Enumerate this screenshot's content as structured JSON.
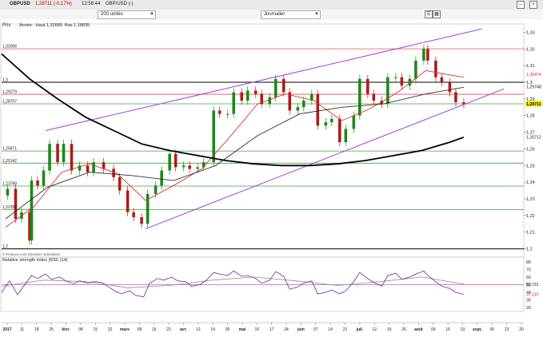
{
  "window": {
    "symbol": "GBPUSD",
    "price": "1,28711 (-0,17%)",
    "time": "12:58:44",
    "instrument": "GBP/USD (-)"
  },
  "toolbar": {
    "units_value": "200 unités",
    "period_value": "Journalier"
  },
  "main_chart": {
    "label": "Prix",
    "legend": "Année: ·Haut 1,32689 ·Bas 1,18835",
    "source": "© Finance.com Données indicatives",
    "y_ticks": [
      "1,33",
      "1,32",
      "1,31",
      "1,3",
      "1,29",
      "1,28",
      "1,27",
      "1,26",
      "1,25",
      "1,24",
      "1,23",
      "1,22",
      "1,21",
      "1,2"
    ],
    "level_labels": [
      "1,32006",
      "1,3",
      "1,29279",
      "1,28707",
      "1,25871",
      "1,25142",
      "1,23768",
      "1,22358",
      "1,2"
    ],
    "right_tags": [
      "1,30474",
      "1,29748",
      "1,28711",
      "1,26712"
    ]
  },
  "rsi": {
    "label": "Relative strength index (RSI) (14)",
    "y_ticks": [
      "80",
      "70",
      "60",
      "50",
      "40",
      "30",
      "20"
    ],
    "right_tags": [
      "50,722",
      "37,310"
    ]
  },
  "x_axis": {
    "labels": [
      "2017",
      "11",
      "18",
      "25",
      "févr.",
      "08",
      "15",
      "22",
      "mars",
      "08",
      "15",
      "22",
      "avr.",
      "12",
      "19",
      "26",
      "mai",
      "10",
      "17",
      "24",
      "juin",
      "07",
      "14",
      "21",
      "juil.",
      "12",
      "19",
      "26",
      "août",
      "09",
      "16",
      "23",
      "sept.",
      "06",
      "13",
      "20"
    ]
  },
  "colors": {
    "channel": "#a040e0",
    "level_red": "#e05050",
    "level_green": "#40a040",
    "level_black": "#000000",
    "ma_red": "#e03030",
    "ma_dark": "#303030",
    "ma_long": "#000000",
    "candle_up": "#1a8a1a",
    "candle_down": "#b01a1a",
    "rsi_line": "#7020a0",
    "rsi_signal": "#909090",
    "tag_blue": "#2040c0",
    "tag_red": "#e02020",
    "tag_current": "#f2e600"
  },
  "chart_data": {
    "type": "candlestick",
    "instrument": "GBP/USD",
    "period": "Journalier",
    "x_start": "2017-01-02",
    "x_end": "2017-09-20",
    "ylim": [
      1.195,
      1.335
    ],
    "year_high": 1.32689,
    "year_low": 1.18835,
    "horizontal_levels": [
      1.32006,
      1.3,
      1.29279,
      1.28707,
      1.25871,
      1.25142,
      1.23768,
      1.22358,
      1.2
    ],
    "channel": {
      "upper": [
        [
          "2017-01-24",
          1.271
        ],
        [
          "2017-08-30",
          1.332
        ]
      ],
      "lower": [
        [
          "2017-03-15",
          1.212
        ],
        [
          "2017-09-10",
          1.296
        ]
      ]
    },
    "close_series": [
      [
        "2017-01-02",
        1.232
      ],
      [
        "2017-01-05",
        1.236
      ],
      [
        "2017-01-09",
        1.218
      ],
      [
        "2017-01-12",
        1.222
      ],
      [
        "2017-01-16",
        1.205
      ],
      [
        "2017-01-17",
        1.241
      ],
      [
        "2017-01-20",
        1.238
      ],
      [
        "2017-01-23",
        1.247
      ],
      [
        "2017-01-26",
        1.263
      ],
      [
        "2017-01-30",
        1.252
      ],
      [
        "2017-02-02",
        1.263
      ],
      [
        "2017-02-06",
        1.247
      ],
      [
        "2017-02-10",
        1.25
      ],
      [
        "2017-02-14",
        1.246
      ],
      [
        "2017-02-17",
        1.252
      ],
      [
        "2017-02-22",
        1.248
      ],
      [
        "2017-02-27",
        1.243
      ],
      [
        "2017-03-02",
        1.235
      ],
      [
        "2017-03-06",
        1.222
      ],
      [
        "2017-03-09",
        1.219
      ],
      [
        "2017-03-13",
        1.215
      ],
      [
        "2017-03-16",
        1.233
      ],
      [
        "2017-03-20",
        1.238
      ],
      [
        "2017-03-23",
        1.247
      ],
      [
        "2017-03-27",
        1.257
      ],
      [
        "2017-03-30",
        1.249
      ],
      [
        "2017-04-03",
        1.25
      ],
      [
        "2017-04-06",
        1.248
      ],
      [
        "2017-04-10",
        1.249
      ],
      [
        "2017-04-13",
        1.252
      ],
      [
        "2017-04-18",
        1.283
      ],
      [
        "2017-04-21",
        1.281
      ],
      [
        "2017-04-25",
        1.281
      ],
      [
        "2017-04-28",
        1.294
      ],
      [
        "2017-05-02",
        1.289
      ],
      [
        "2017-05-05",
        1.295
      ],
      [
        "2017-05-09",
        1.293
      ],
      [
        "2017-05-12",
        1.287
      ],
      [
        "2017-05-16",
        1.291
      ],
      [
        "2017-05-19",
        1.302
      ],
      [
        "2017-05-23",
        1.294
      ],
      [
        "2017-05-26",
        1.283
      ],
      [
        "2017-05-30",
        1.285
      ],
      [
        "2017-06-02",
        1.289
      ],
      [
        "2017-06-06",
        1.293
      ],
      [
        "2017-06-09",
        1.274
      ],
      [
        "2017-06-13",
        1.276
      ],
      [
        "2017-06-16",
        1.278
      ],
      [
        "2017-06-20",
        1.264
      ],
      [
        "2017-06-23",
        1.272
      ],
      [
        "2017-06-27",
        1.28
      ],
      [
        "2017-06-30",
        1.302
      ],
      [
        "2017-07-04",
        1.293
      ],
      [
        "2017-07-07",
        1.289
      ],
      [
        "2017-07-11",
        1.287
      ],
      [
        "2017-07-14",
        1.303
      ],
      [
        "2017-07-18",
        1.303
      ],
      [
        "2017-07-21",
        1.298
      ],
      [
        "2017-07-25",
        1.302
      ],
      [
        "2017-07-28",
        1.313
      ],
      [
        "2017-08-01",
        1.32
      ],
      [
        "2017-08-03",
        1.313
      ],
      [
        "2017-08-07",
        1.303
      ],
      [
        "2017-08-10",
        1.3
      ],
      [
        "2017-08-14",
        1.294
      ],
      [
        "2017-08-17",
        1.288
      ],
      [
        "2017-08-21",
        1.287
      ]
    ],
    "moving_averages": [
      {
        "color": "#e03030",
        "points": [
          [
            "2017-01-04",
            1.213
          ],
          [
            "2017-01-18",
            1.225
          ],
          [
            "2017-02-01",
            1.246
          ],
          [
            "2017-02-15",
            1.251
          ],
          [
            "2017-03-01",
            1.245
          ],
          [
            "2017-03-15",
            1.229
          ],
          [
            "2017-03-29",
            1.238
          ],
          [
            "2017-04-12",
            1.248
          ],
          [
            "2017-04-26",
            1.267
          ],
          [
            "2017-05-10",
            1.287
          ],
          [
            "2017-05-24",
            1.293
          ],
          [
            "2017-06-07",
            1.289
          ],
          [
            "2017-06-21",
            1.277
          ],
          [
            "2017-07-05",
            1.284
          ],
          [
            "2017-07-19",
            1.294
          ],
          [
            "2017-08-02",
            1.307
          ],
          [
            "2017-08-16",
            1.304
          ],
          [
            "2017-08-21",
            1.303
          ]
        ]
      },
      {
        "color": "#303030",
        "points": [
          [
            "2017-01-04",
            1.218
          ],
          [
            "2017-01-25",
            1.237
          ],
          [
            "2017-02-15",
            1.246
          ],
          [
            "2017-03-08",
            1.244
          ],
          [
            "2017-03-29",
            1.241
          ],
          [
            "2017-04-19",
            1.25
          ],
          [
            "2017-05-10",
            1.268
          ],
          [
            "2017-05-31",
            1.281
          ],
          [
            "2017-06-21",
            1.285
          ],
          [
            "2017-07-12",
            1.287
          ],
          [
            "2017-08-02",
            1.293
          ],
          [
            "2017-08-21",
            1.297
          ]
        ]
      },
      {
        "color": "#000000",
        "points": [
          [
            "2017-01-02",
            1.317
          ],
          [
            "2017-01-16",
            1.302
          ],
          [
            "2017-01-30",
            1.29
          ],
          [
            "2017-02-13",
            1.279
          ],
          [
            "2017-02-27",
            1.271
          ],
          [
            "2017-03-13",
            1.263
          ],
          [
            "2017-03-27",
            1.259
          ],
          [
            "2017-04-10",
            1.256
          ],
          [
            "2017-04-24",
            1.253
          ],
          [
            "2017-05-08",
            1.251
          ],
          [
            "2017-05-22",
            1.25
          ],
          [
            "2017-06-05",
            1.25
          ],
          [
            "2017-06-19",
            1.251
          ],
          [
            "2017-07-03",
            1.253
          ],
          [
            "2017-07-17",
            1.256
          ],
          [
            "2017-07-31",
            1.259
          ],
          [
            "2017-08-14",
            1.264
          ],
          [
            "2017-08-21",
            1.267
          ]
        ]
      }
    ],
    "rsi": {
      "ylim": [
        15,
        85
      ],
      "reference_level": 50,
      "values": [
        [
          "2017-01-02",
          40
        ],
        [
          "2017-01-06",
          55
        ],
        [
          "2017-01-10",
          37
        ],
        [
          "2017-01-13",
          48
        ],
        [
          "2017-01-17",
          62
        ],
        [
          "2017-01-20",
          58
        ],
        [
          "2017-01-24",
          64
        ],
        [
          "2017-01-27",
          57
        ],
        [
          "2017-01-31",
          60
        ],
        [
          "2017-02-03",
          55
        ],
        [
          "2017-02-07",
          51
        ],
        [
          "2017-02-10",
          55
        ],
        [
          "2017-02-14",
          52
        ],
        [
          "2017-02-17",
          54
        ],
        [
          "2017-02-21",
          53
        ],
        [
          "2017-02-24",
          48
        ],
        [
          "2017-02-28",
          41
        ],
        [
          "2017-03-03",
          38
        ],
        [
          "2017-03-07",
          42
        ],
        [
          "2017-03-10",
          36
        ],
        [
          "2017-03-14",
          34
        ],
        [
          "2017-03-17",
          52
        ],
        [
          "2017-03-21",
          58
        ],
        [
          "2017-03-24",
          56
        ],
        [
          "2017-03-28",
          60
        ],
        [
          "2017-03-31",
          55
        ],
        [
          "2017-04-04",
          54
        ],
        [
          "2017-04-07",
          48
        ],
        [
          "2017-04-11",
          50
        ],
        [
          "2017-04-14",
          55
        ],
        [
          "2017-04-18",
          66
        ],
        [
          "2017-04-21",
          64
        ],
        [
          "2017-04-25",
          62
        ],
        [
          "2017-04-28",
          68
        ],
        [
          "2017-05-02",
          61
        ],
        [
          "2017-05-05",
          62
        ],
        [
          "2017-05-09",
          58
        ],
        [
          "2017-05-12",
          52
        ],
        [
          "2017-05-16",
          56
        ],
        [
          "2017-05-19",
          67
        ],
        [
          "2017-05-23",
          61
        ],
        [
          "2017-05-26",
          44
        ],
        [
          "2017-05-30",
          47
        ],
        [
          "2017-06-02",
          52
        ],
        [
          "2017-06-06",
          55
        ],
        [
          "2017-06-09",
          38
        ],
        [
          "2017-06-13",
          40
        ],
        [
          "2017-06-16",
          43
        ],
        [
          "2017-06-20",
          38
        ],
        [
          "2017-06-23",
          42
        ],
        [
          "2017-06-27",
          54
        ],
        [
          "2017-06-30",
          66
        ],
        [
          "2017-07-04",
          58
        ],
        [
          "2017-07-07",
          53
        ],
        [
          "2017-07-11",
          48
        ],
        [
          "2017-07-14",
          62
        ],
        [
          "2017-07-18",
          65
        ],
        [
          "2017-07-21",
          57
        ],
        [
          "2017-07-25",
          60
        ],
        [
          "2017-07-28",
          64
        ],
        [
          "2017-08-01",
          68
        ],
        [
          "2017-08-03",
          62
        ],
        [
          "2017-08-07",
          54
        ],
        [
          "2017-08-10",
          48
        ],
        [
          "2017-08-14",
          45
        ],
        [
          "2017-08-17",
          40
        ],
        [
          "2017-08-21",
          37.31
        ]
      ],
      "signal": [
        [
          "2017-01-02",
          48
        ],
        [
          "2017-01-23",
          56
        ],
        [
          "2017-02-13",
          54
        ],
        [
          "2017-03-06",
          46
        ],
        [
          "2017-03-27",
          49
        ],
        [
          "2017-04-17",
          56
        ],
        [
          "2017-05-08",
          60
        ],
        [
          "2017-05-29",
          55
        ],
        [
          "2017-06-19",
          49
        ],
        [
          "2017-07-10",
          54
        ],
        [
          "2017-07-31",
          60
        ],
        [
          "2017-08-21",
          50.722
        ]
      ]
    }
  }
}
